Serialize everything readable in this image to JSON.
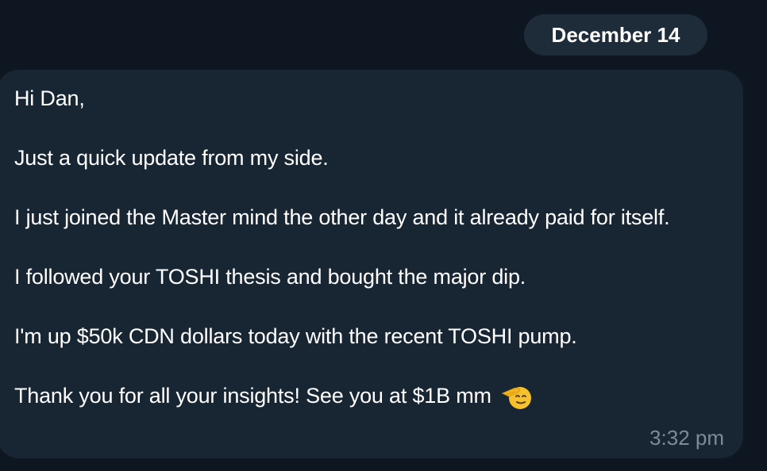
{
  "chat": {
    "date_label": "December 14",
    "message": {
      "greeting": "Hi Dan,",
      "line1": "Just a quick update from my side.",
      "line2": "I just joined the Master mind the other day and it already paid for itself.",
      "line3": "I followed your TOSHI thesis and bought the major dip.",
      "line4": "I'm up $50k CDN dollars today with the recent TOSHI pump.",
      "line5": "Thank you for all your insights! See you at $1B mm",
      "emoji": "saluting-face",
      "time": "3:32 pm"
    },
    "colors": {
      "background": "#0e1621",
      "bubble": "#182533",
      "date_pill": "#1e2c3a",
      "time_text": "#7d8b99"
    }
  }
}
